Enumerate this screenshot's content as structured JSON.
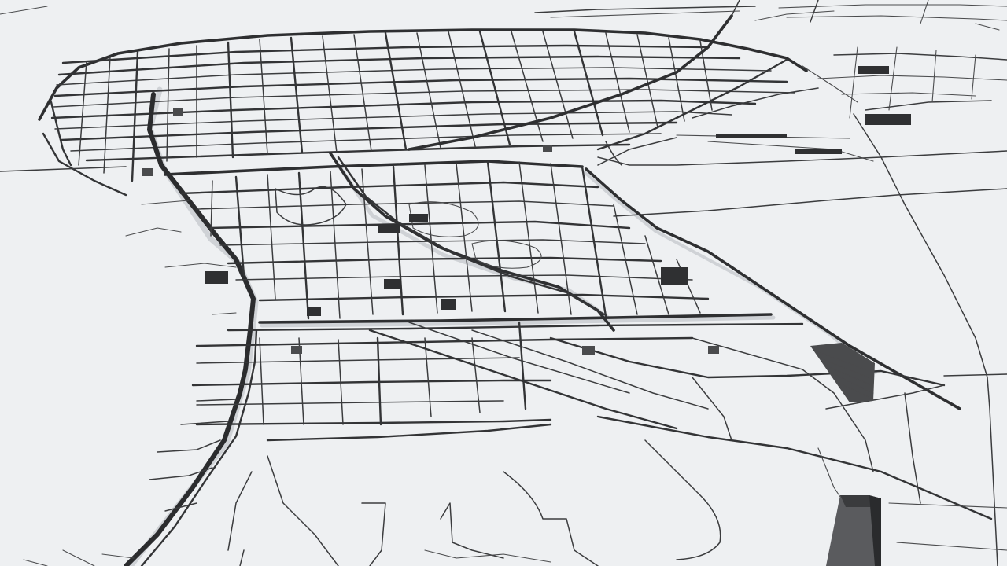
{
  "scene": {
    "background_color": "#eef0f2",
    "road_color": "#2e2f31",
    "building_color": "#2f3032",
    "shadow_color": "#cfd2d6"
  },
  "layers": [
    {
      "name": "ground-plane",
      "icon": "ground"
    },
    {
      "name": "downtown-street-grid",
      "icon": "grid"
    },
    {
      "name": "freeway",
      "icon": "highway"
    },
    {
      "name": "rail-corridor",
      "icon": "rail"
    },
    {
      "name": "southern-districts",
      "icon": "street"
    },
    {
      "name": "highway-outskirts",
      "icon": "highway"
    },
    {
      "name": "extruded-buildings",
      "icon": "building"
    }
  ]
}
